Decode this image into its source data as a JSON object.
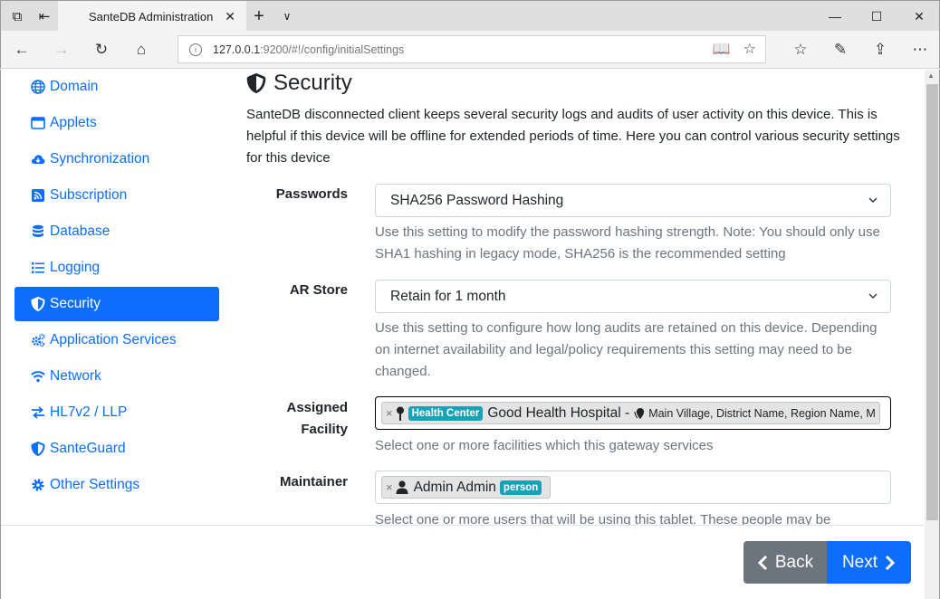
{
  "browser": {
    "tab_title": "SanteDB Administration",
    "url_host": "127.0.0.1",
    "url_rest": ":9200/#!/config/initialSettings"
  },
  "sidebar": {
    "items": [
      {
        "label": "Domain",
        "icon": "globe-icon"
      },
      {
        "label": "Applets",
        "icon": "window-icon"
      },
      {
        "label": "Synchronization",
        "icon": "cloud-download-icon"
      },
      {
        "label": "Subscription",
        "icon": "rss-icon"
      },
      {
        "label": "Database",
        "icon": "database-icon"
      },
      {
        "label": "Logging",
        "icon": "list-icon"
      },
      {
        "label": "Security",
        "icon": "shield-icon",
        "active": true
      },
      {
        "label": "Application Services",
        "icon": "cogs-icon"
      },
      {
        "label": "Network",
        "icon": "wifi-icon"
      },
      {
        "label": "HL7v2 / LLP",
        "icon": "exchange-icon"
      },
      {
        "label": "SanteGuard",
        "icon": "shield-icon"
      },
      {
        "label": "Other Settings",
        "icon": "gear-icon"
      }
    ]
  },
  "main": {
    "title": "Security",
    "intro": "SanteDB disconnected client keeps several security logs and audits of user activity on this device. This is helpful if this device will be offline for extended periods of time. Here you can control various security settings for this device",
    "passwords": {
      "label": "Passwords",
      "value": "SHA256 Password Hashing",
      "help": "Use this setting to modify the password hashing strength. Note: You should only use SHA1 hashing in legacy mode, SHA256 is the recommended setting"
    },
    "ar_store": {
      "label": "AR Store",
      "value": "Retain for 1 month",
      "help": "Use this setting to configure how long audits are retained on this device. Depending on internet availability and legal/policy requirements this setting may need to be changed."
    },
    "facility": {
      "label": "Assigned Facility",
      "chip_remove": "×",
      "badge": "Health Center",
      "name": "Good Health Hospital -",
      "location": "Main Village, District Name, Region Name, M",
      "help": "Select one or more facilities which this gateway services"
    },
    "maintainer": {
      "label": "Maintainer",
      "chip_remove": "×",
      "name": "Admin Admin",
      "badge": "person",
      "help": "Select one or more users that will be using this tablet. These people may be"
    }
  },
  "footer": {
    "back_label": "Back",
    "next_label": "Next"
  },
  "colors": {
    "primary": "#0d6efd",
    "secondary": "#6c757d",
    "badge": "#17a2b8"
  }
}
